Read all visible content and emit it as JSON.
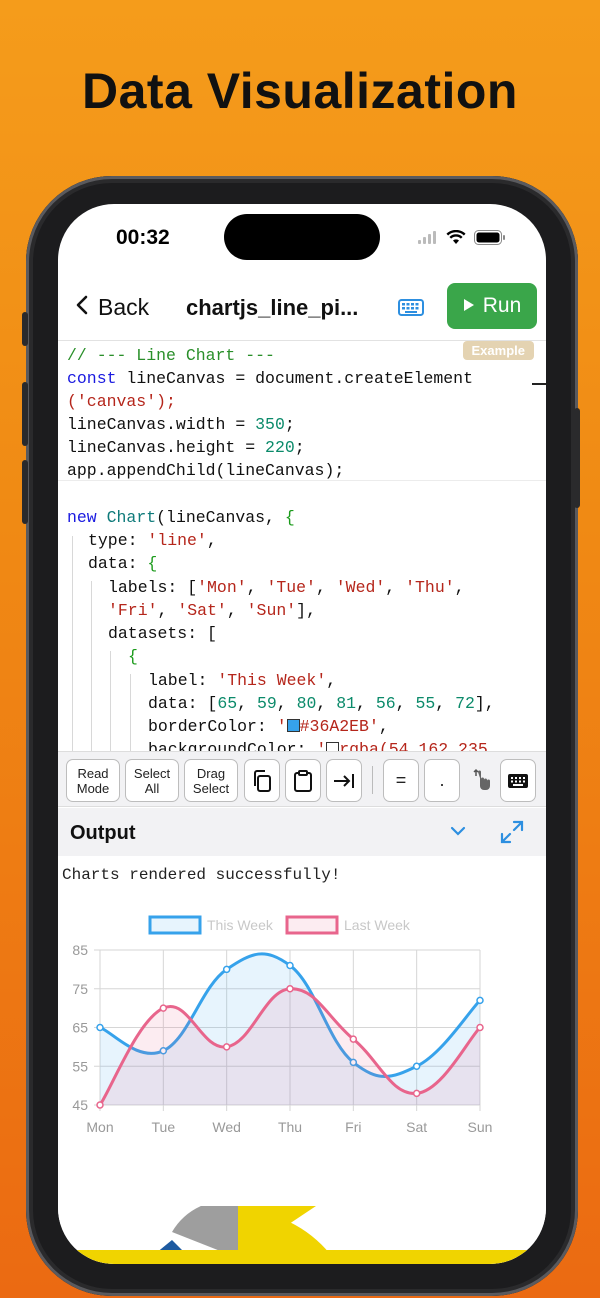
{
  "headline": "Data Visualization",
  "status": {
    "time": "00:32"
  },
  "nav": {
    "back_label": "Back",
    "title": "chartjs_line_pi...",
    "run_label": "Run"
  },
  "editor": {
    "badge": "Example",
    "lines": [
      "// --- Line Chart ---",
      "const lineCanvas = document.createElement",
      "('canvas');",
      "lineCanvas.width = 350;",
      "lineCanvas.height = 220;",
      "app.appendChild(lineCanvas);",
      "",
      "new Chart(lineCanvas, {",
      "type: 'line',",
      "data: {",
      "labels: ['Mon', 'Tue', 'Wed', 'Thu',",
      "'Fri', 'Sat', 'Sun'],",
      "datasets: [",
      "{",
      "label: 'This Week',",
      "data: [65, 59, 80, 81, 56, 55, 72],",
      "borderColor: '#36A2EB',",
      "backgroundColor: 'rgba(54,162,235"
    ]
  },
  "toolbar": {
    "read_mode": "Read Mode",
    "select_all": "Select All",
    "drag_select": "Drag Select",
    "equals": "=",
    "period": "."
  },
  "output": {
    "title": "Output",
    "message": "Charts rendered successfully!"
  },
  "colors": {
    "this_week": "#36A2EB",
    "last_week": "#E8658C",
    "run_green": "#3aa64a"
  },
  "chart_data": {
    "type": "line",
    "categories": [
      "Mon",
      "Tue",
      "Wed",
      "Thu",
      "Fri",
      "Sat",
      "Sun"
    ],
    "series": [
      {
        "name": "This Week",
        "values": [
          65,
          59,
          80,
          81,
          56,
          55,
          72
        ],
        "color": "#36A2EB"
      },
      {
        "name": "Last Week",
        "values": [
          45,
          70,
          60,
          75,
          62,
          48,
          65
        ],
        "color": "#E8658C"
      }
    ],
    "yticks": [
      45,
      55,
      65,
      75,
      85
    ],
    "ylim": [
      45,
      85
    ],
    "grid": true,
    "legend": "top"
  }
}
